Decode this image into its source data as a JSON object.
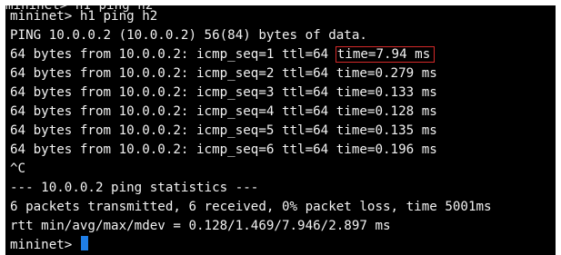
{
  "terminal": {
    "clipped_top": "mininet> h1 ping h2",
    "lines": [
      "mininet> h1 ping h2",
      "PING 10.0.0.2 (10.0.0.2) 56(84) bytes of data.",
      "64 bytes from 10.0.0.2: icmp_seq=1 ttl=64 ",
      "64 bytes from 10.0.0.2: icmp_seq=2 ttl=64 time=0.279 ms",
      "64 bytes from 10.0.0.2: icmp_seq=3 ttl=64 time=0.133 ms",
      "64 bytes from 10.0.0.2: icmp_seq=4 ttl=64 time=0.128 ms",
      "64 bytes from 10.0.0.2: icmp_seq=5 ttl=64 time=0.135 ms",
      "64 bytes from 10.0.0.2: icmp_seq=6 ttl=64 time=0.196 ms",
      "^C",
      "--- 10.0.0.2 ping statistics ---",
      "6 packets transmitted, 6 received, 0% packet loss, time 5001ms",
      "rtt min/avg/max/mdev = 0.128/1.469/7.946/2.897 ms",
      "mininet> "
    ],
    "highlight_time": "time=7.94 ms"
  },
  "colors": {
    "background": "#000000",
    "text": "#f2f2f2",
    "highlight_box": "#d42a2a",
    "cursor": "#1f7ee6"
  }
}
